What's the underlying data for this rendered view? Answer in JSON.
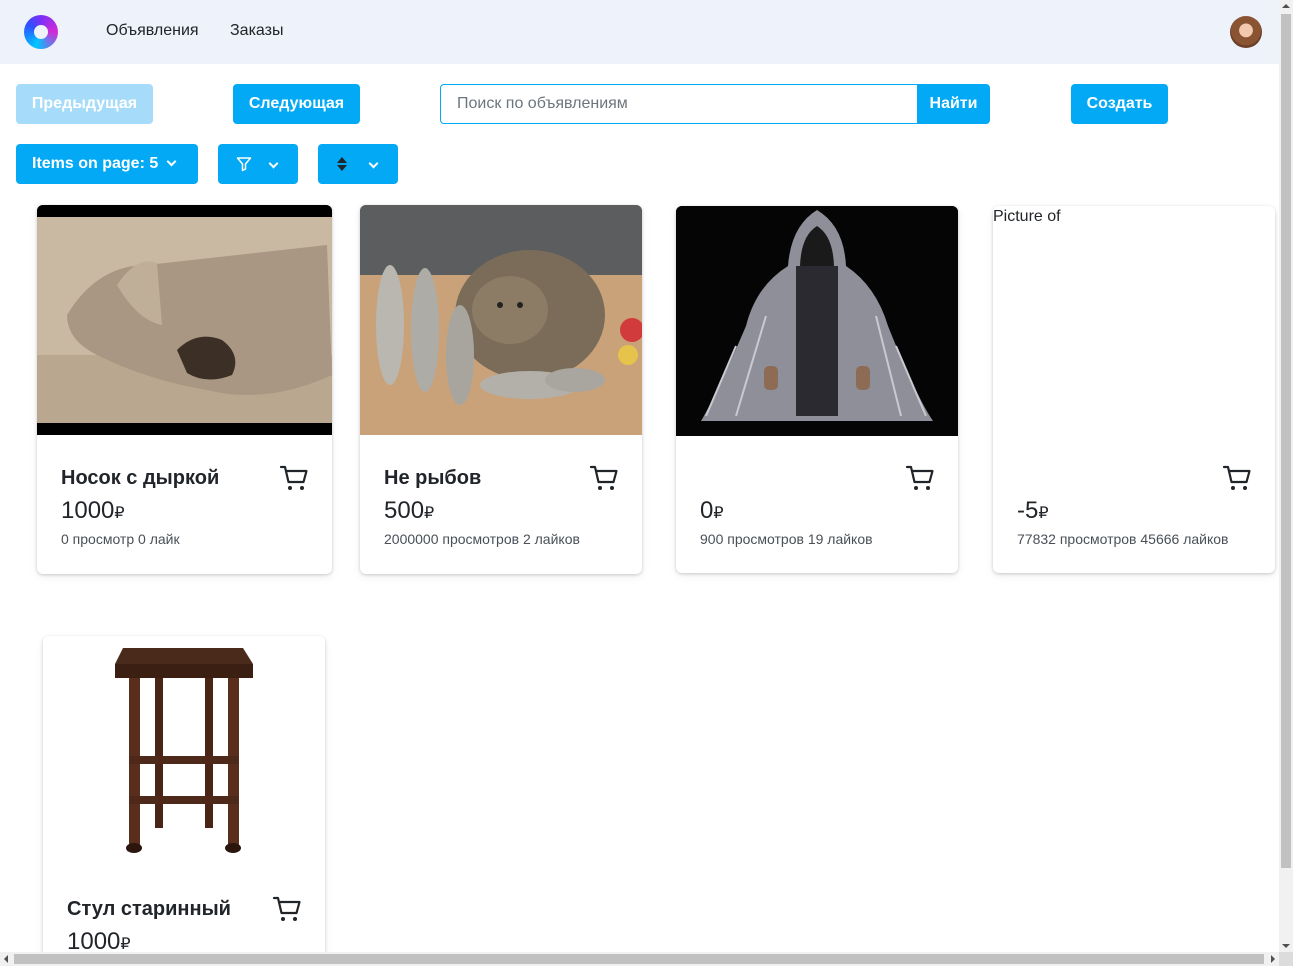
{
  "navbar": {
    "links": [
      "Объявления",
      "Заказы"
    ]
  },
  "toolbar": {
    "prev_label": "Предыдущая",
    "next_label": "Следующая",
    "search_placeholder": "Поиск по объявлениям",
    "search_value": "",
    "search_button": "Найти",
    "create_label": "Создать",
    "items_per_page_label": "Items on page: 5"
  },
  "currency": "₽",
  "cards": [
    {
      "title": "Носок с дыркой",
      "price": "1000",
      "stats": "0 просмотр  0 лайк",
      "image": "sock-photo"
    },
    {
      "title": "Не рыбов",
      "price": "500",
      "stats": "2000000 просмотров  2 лайков",
      "image": "cat-with-fish-photo"
    },
    {
      "title": "",
      "price": "0",
      "stats": "900 просмотров  19 лайков",
      "image": "hooded-cloak-photo"
    },
    {
      "title": "",
      "price": "-5",
      "stats": "77832 просмотров  45666 лайков",
      "image": "broken-image",
      "image_alt": "Picture of"
    },
    {
      "title": "Стул старинный",
      "price": "1000",
      "stats": "",
      "image": "wooden-stool-photo"
    }
  ],
  "icons": {
    "cart": "shopping-cart-icon",
    "filter": "filter-icon",
    "sort": "sort-icon",
    "dropdown": "chevron-down-icon"
  },
  "colors": {
    "accent": "#03a9f4",
    "accent_disabled": "#a6dcf9",
    "navbar_bg": "#eef2fa"
  }
}
